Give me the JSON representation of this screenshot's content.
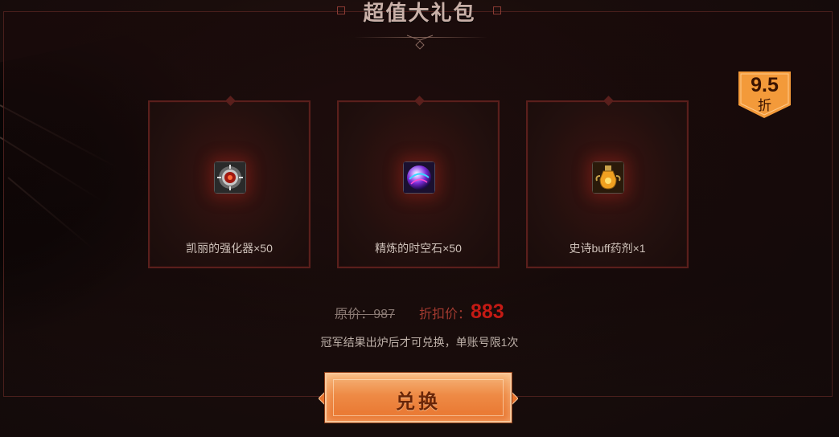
{
  "header": {
    "title": "超值大礼包"
  },
  "badge": {
    "discount": "9.5",
    "unit": "折",
    "color": "#f39a3a"
  },
  "items": [
    {
      "label": "凯丽的强化器×50",
      "icon": "enhancer-icon"
    },
    {
      "label": "精炼的时空石×50",
      "icon": "spacetime-stone-icon"
    },
    {
      "label": "史诗buff药剂×1",
      "icon": "epic-buff-potion-icon"
    }
  ],
  "pricing": {
    "original_label": "原价：",
    "original_value": "987",
    "discount_label": "折扣价：",
    "discount_value": "883",
    "note": "冠军结果出炉后才可兑换，单账号限1次"
  },
  "actions": {
    "redeem_label": "兑换"
  },
  "colors": {
    "accent": "#c41a14",
    "button": "#ee8a45",
    "frame": "#5a1f1c"
  }
}
